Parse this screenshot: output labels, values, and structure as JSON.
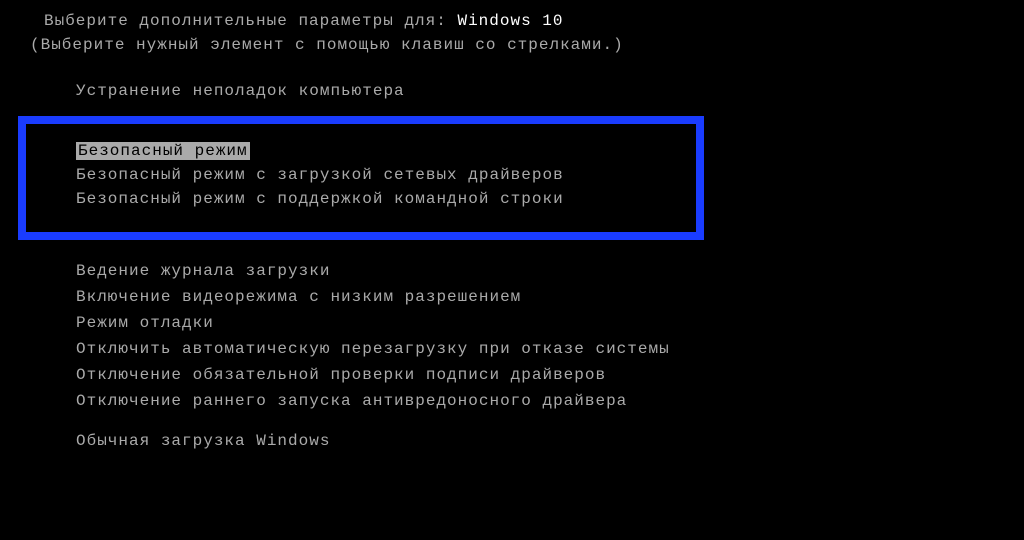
{
  "header": {
    "prefix": "Выберите дополнительные параметры для:",
    "os": "Windows 10",
    "instruction": "(Выберите нужный элемент с помощью клавиш со стрелками.)"
  },
  "menu": {
    "repair": "Устранение неполадок компьютера",
    "safe_mode_group": {
      "safe_mode": "Безопасный режим",
      "safe_mode_networking": "Безопасный режим с загрузкой сетевых драйверов",
      "safe_mode_cmd": "Безопасный режим с поддержкой командной строки"
    },
    "other_group": {
      "boot_logging": "Ведение журнала загрузки",
      "low_res_video": "Включение видеорежима с низким разрешением",
      "debug_mode": "Режим отладки",
      "disable_auto_restart": "Отключить автоматическую перезагрузку при отказе системы",
      "disable_driver_sig": "Отключение обязательной проверки подписи драйверов",
      "disable_antimalware": "Отключение раннего запуска антивредоносного драйвера"
    },
    "normal": "Обычная загрузка Windows"
  },
  "selected_item": "safe_mode"
}
